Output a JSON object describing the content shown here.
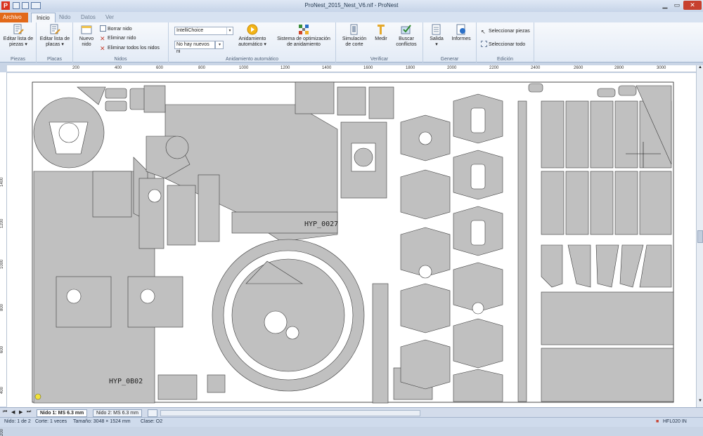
{
  "window": {
    "title": "ProNest_2015_Nest_V6.nif - ProNest",
    "app_icon_letter": "P"
  },
  "tabs": [
    "Archivo",
    "Inicio",
    "Nido",
    "Datos",
    "Ver"
  ],
  "ribbon": {
    "groups": {
      "piezas": {
        "label": "Piezas",
        "edit_parts": "Editar lista de piezas"
      },
      "placas": {
        "label": "Placas",
        "edit_plates": "Editar lista de placas"
      },
      "nidos": {
        "label": "Nidos",
        "new_nest": "Nuevo nido",
        "clear_nest": "Borrar nido",
        "delete_nest": "Eliminar nido",
        "delete_all": "Eliminar todos los nidos"
      },
      "auto": {
        "label": "Anidamiento automático",
        "mode": "IntelliChoice",
        "no_nests": "No hay nuevos ni",
        "auto_nest": "Anidamiento automático",
        "optimize": "Sistema de optimización de anidamiento"
      },
      "verificar": {
        "label": "Verificar",
        "simulation": "Simulación de corte",
        "measure": "Medir",
        "conflicts": "Buscar conflictos"
      },
      "generar": {
        "label": "Generar",
        "output": "Salida",
        "reports": "Informes"
      },
      "edicion": {
        "label": "Edición",
        "select_parts": "Seleccionar piezas",
        "select_all": "Seleccionar todo"
      }
    }
  },
  "rulers": {
    "h_ticks": [
      "200",
      "400",
      "600",
      "800",
      "1000",
      "1200",
      "1400",
      "1600",
      "1800",
      "2000",
      "2200",
      "2400",
      "2600",
      "2800",
      "3000"
    ],
    "v_ticks": [
      "1400",
      "1200",
      "1000",
      "800",
      "600",
      "400",
      "200"
    ]
  },
  "nest": {
    "labels": [
      "HYP_0027",
      "HYP_0B02"
    ]
  },
  "sheet_tabs": [
    "Nido 1: MS 6.3 mm",
    "Nido 2: MS 6.3 mm"
  ],
  "status": {
    "nest": "Nido: 1 de 2",
    "cuts": "Corte: 1 veces",
    "size": "Tamaño: 3048 × 1524 mm",
    "class": "Clase: O2",
    "machine": "HFL020 IN"
  },
  "colors": {
    "part_fill": "#c0c0c0",
    "file_tab": "#e2691a",
    "close_button": "#c7402e"
  }
}
